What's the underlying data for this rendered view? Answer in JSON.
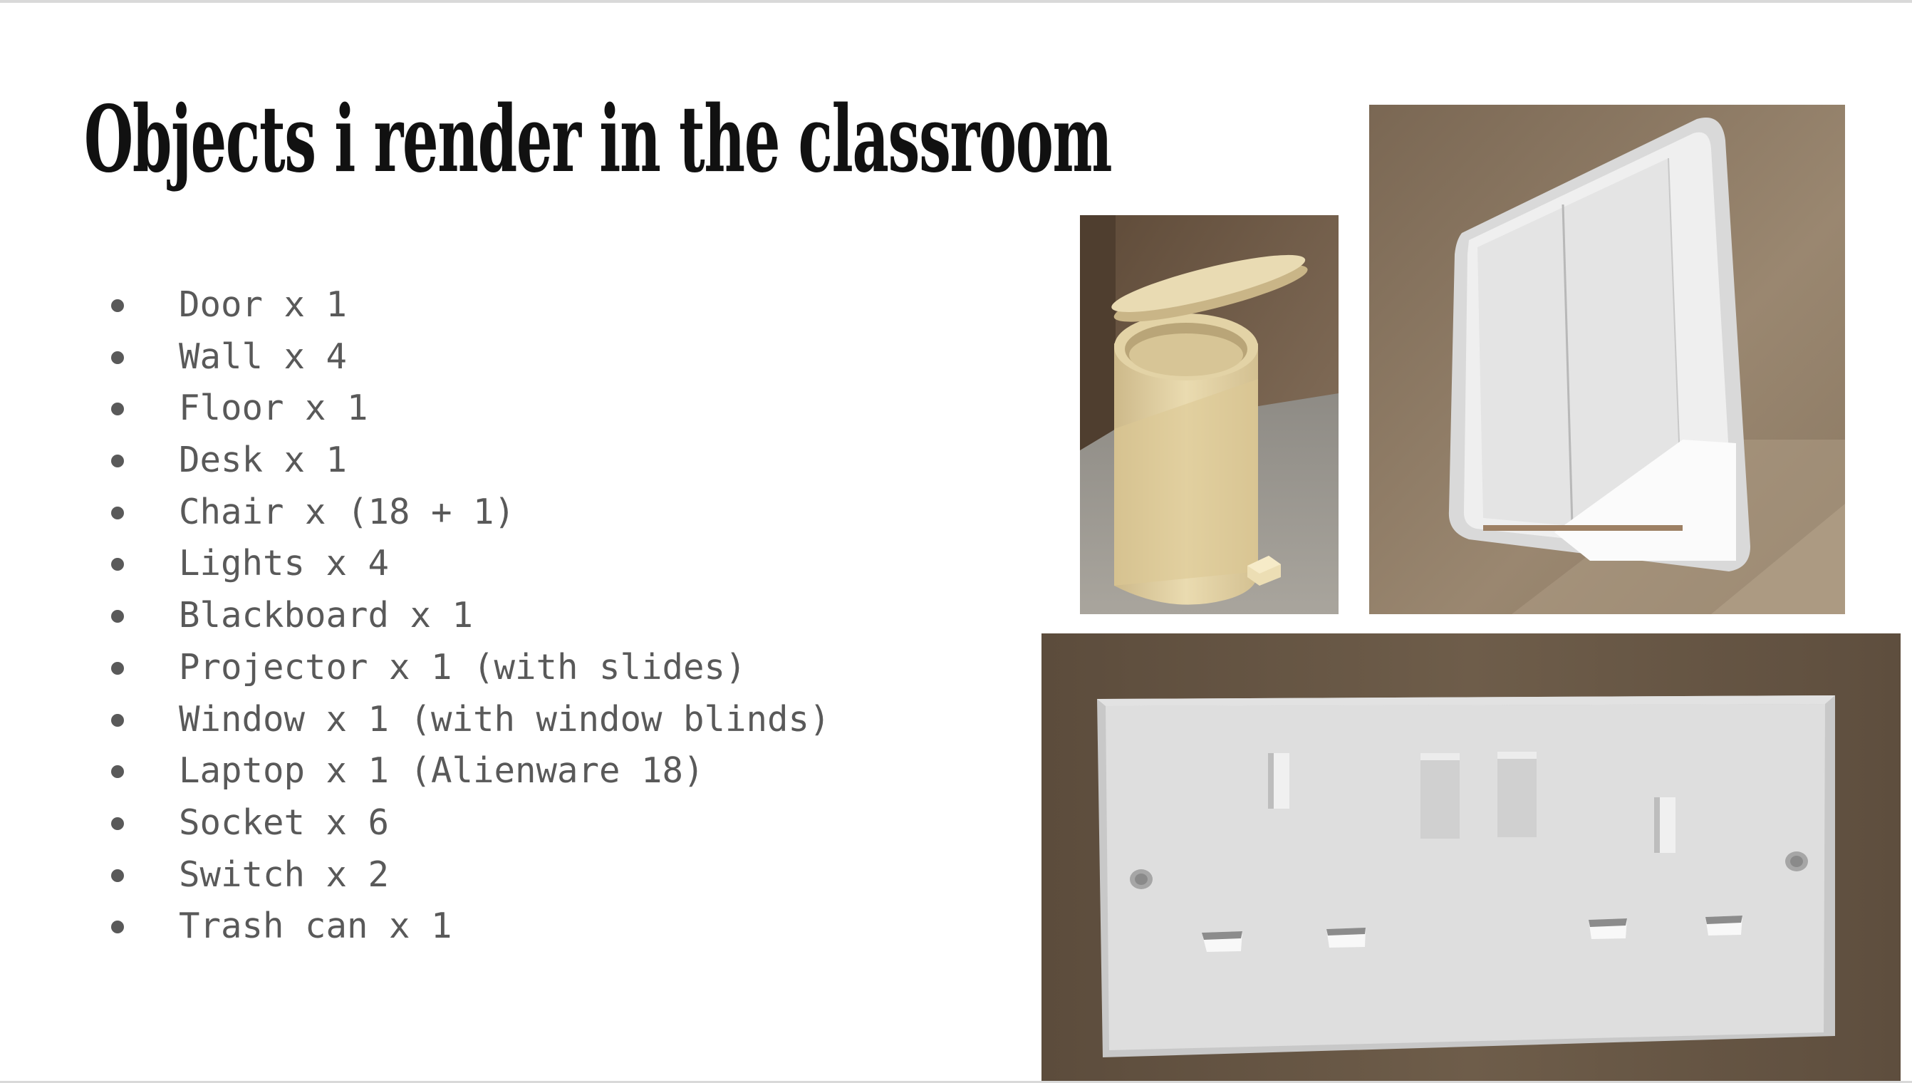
{
  "slide": {
    "title": "Objects i render in the classroom",
    "items": [
      "Door x 1",
      "Wall x 4",
      "Floor x 1",
      "Desk x 1",
      "Chair x (18 + 1)",
      "Lights x 4",
      "Blackboard x 1",
      "Projector x 1 (with slides)",
      "Window x 1 (with window blinds)",
      "Laptop x 1 (Alienware 18)",
      "Socket x 6",
      "Switch x 2",
      "Trash can x 1"
    ]
  },
  "colors": {
    "title": "#111111",
    "bullet_text": "#595959",
    "wall_brown": "#6b5a47",
    "fixture_white": "#e8e8e8",
    "bin_beige": "#e2d2a4"
  },
  "images": [
    "trash-can-render",
    "light-switch-render",
    "wall-socket-render"
  ]
}
